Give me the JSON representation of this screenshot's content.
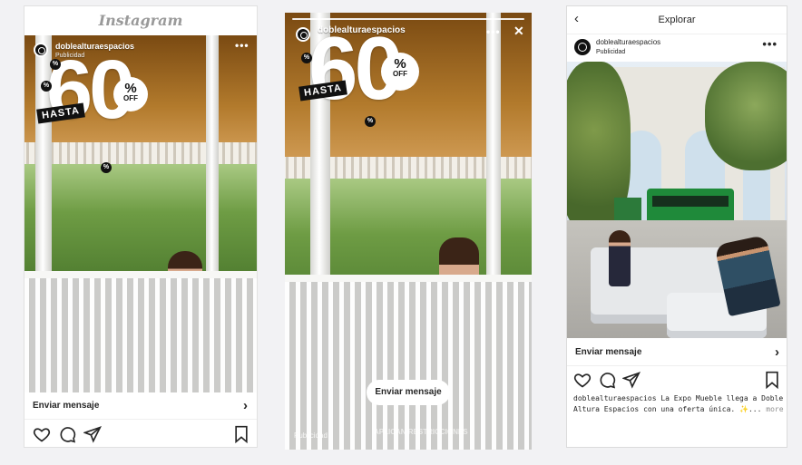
{
  "feed_post": {
    "app_logo": "Instagram",
    "username": "doblealturaespacios",
    "sponsored_label": "Publicidad",
    "promo_number": "60",
    "promo_percent": "%",
    "promo_off": "OFF",
    "promo_hasta": "HASTA",
    "cta_label": "Enviar mensaje",
    "icons": [
      "heart-icon",
      "comment-icon",
      "share-icon",
      "bookmark-icon"
    ]
  },
  "story": {
    "username": "doblealturaespacios",
    "promo_number": "60",
    "promo_percent": "%",
    "promo_off": "OFF",
    "promo_hasta": "HASTA",
    "cta_label": "Enviar mensaje",
    "footer_left": "Publicidad",
    "footer_center": "APLICAN RESTRICCIONES"
  },
  "explore_post": {
    "title": "Explorar",
    "username": "doblealturaespacios",
    "sponsored_label": "Publicidad",
    "cta_label": "Enviar mensaje",
    "caption_user": "doblealturaespacios",
    "caption_text": "La Expo Mueble llega a Doble Altura Espacios con una oferta única. ✨...",
    "caption_more": "more"
  },
  "colors": {
    "text": "#262626",
    "secondary": "#8e8e8e",
    "background": "#f2f2f4"
  }
}
